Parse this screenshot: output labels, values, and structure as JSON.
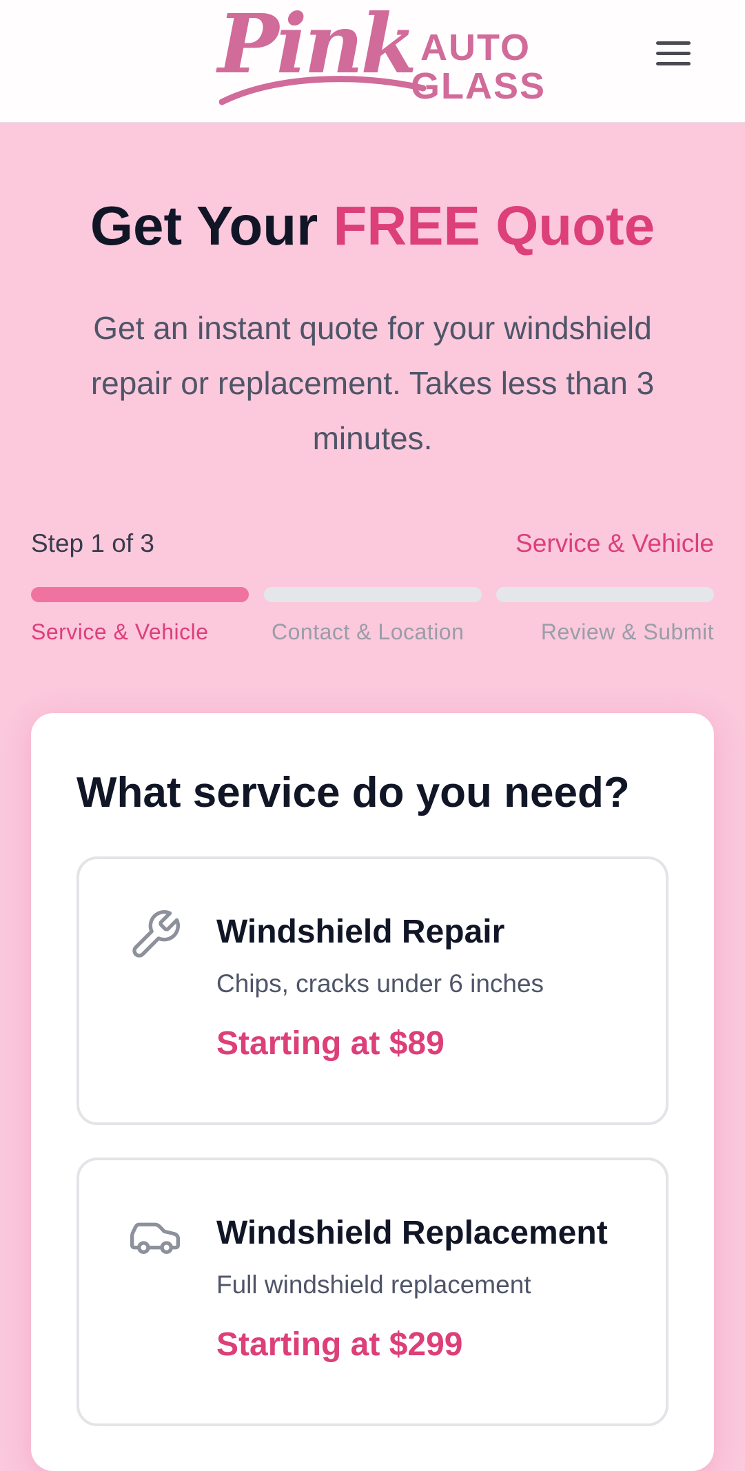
{
  "header": {
    "logo_script": "Pink",
    "logo_line1": "AUTO",
    "logo_line2": "GLASS",
    "menu_icon": "hamburger-menu-icon"
  },
  "hero": {
    "title_prefix": "Get Your ",
    "title_accent": "FREE Quote",
    "subtitle": "Get an instant quote for your windshield repair or replacement. Takes less than 3 minutes."
  },
  "progress": {
    "step_count": "Step 1 of 3",
    "current_label": "Service & Vehicle",
    "current_step": 1,
    "steps": [
      {
        "label": "Service & Vehicle",
        "active": true
      },
      {
        "label": "Contact & Location",
        "active": false
      },
      {
        "label": "Review & Submit",
        "active": false
      }
    ]
  },
  "form": {
    "title": "What service do you need?",
    "options": [
      {
        "icon": "wrench-icon",
        "name": "Windshield Repair",
        "description": "Chips, cracks under 6 inches",
        "price": "Starting at $89"
      },
      {
        "icon": "car-icon",
        "name": "Windshield Replacement",
        "description": "Full windshield replacement",
        "price": "Starting at $299"
      }
    ]
  },
  "colors": {
    "brand_pink": "#d06b9a",
    "accent": "#dd3f78",
    "progress_active": "#f0739f",
    "page_bg": "#fbc8dc"
  }
}
